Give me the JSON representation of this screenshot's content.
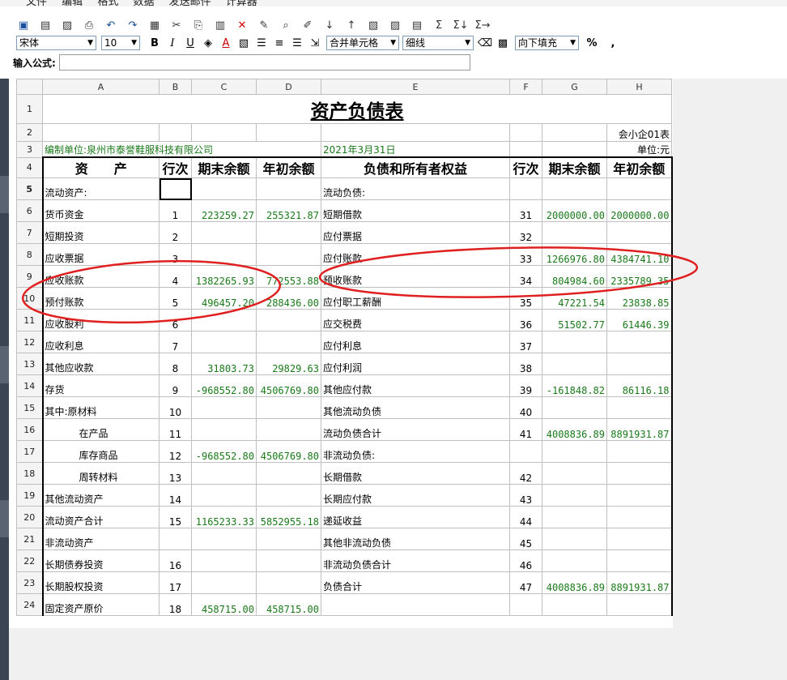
{
  "menu": [
    "文件",
    "编辑",
    "格式",
    "数据",
    "发送邮件",
    "计算器"
  ],
  "toolbar_icons": [
    "save-icon",
    "save-as-icon",
    "print-preview-icon",
    "print-icon",
    "undo-icon",
    "redo-icon",
    "insert-object-icon",
    "cut-icon",
    "copy-icon",
    "paste-icon",
    "delete-icon",
    "format-painter-icon",
    "find-icon",
    "replace-icon",
    "sort-ascending-icon",
    "sort-descending-icon",
    "paste-special-icon",
    "paste-value-icon",
    "clipboard-icon",
    "sum-icon",
    "sum-row-icon",
    "sum-col-icon"
  ],
  "toolbar_glyphs": [
    "▣",
    "▤",
    "▨",
    "⎙",
    "↶",
    "↷",
    "▦",
    "✂",
    "⎘",
    "▥",
    "✕",
    "✎",
    "⌕",
    "✐",
    "↓",
    "↑",
    "▧",
    "▨",
    "▤",
    "Σ",
    "Σ↓",
    "Σ→"
  ],
  "format": {
    "font": "宋体",
    "size": "10",
    "merge": "合并单元格",
    "border": "细线",
    "fill": "向下填充",
    "percent": "%",
    "comma": ","
  },
  "formula": {
    "label": "输入公式:",
    "value": ""
  },
  "columns": [
    "A",
    "B",
    "C",
    "D",
    "E",
    "F",
    "G",
    "H"
  ],
  "sheet": {
    "title": "资产负债表",
    "form_code": "会小企01表",
    "unit_label": "编制单位:泉州市泰誉鞋服科技有限公司",
    "date": "2021年3月31日",
    "currency": "单位:元",
    "headers": [
      "资　　产",
      "行次",
      "期末余额",
      "年初余额",
      "负债和所有者权益",
      "行次",
      "期末余额",
      "年初余额"
    ],
    "rows": [
      {
        "n": "5",
        "a": "流动资产:",
        "b": "",
        "c": "",
        "d": "",
        "e": "流动负债:",
        "f": "",
        "g": "",
        "h": ""
      },
      {
        "n": "6",
        "a": "货币资金",
        "b": "1",
        "c": "223259.27",
        "d": "255321.87",
        "e": "短期借款",
        "f": "31",
        "g": "2000000.00",
        "h": "2000000.00"
      },
      {
        "n": "7",
        "a": "短期投资",
        "b": "2",
        "c": "",
        "d": "",
        "e": "应付票据",
        "f": "32",
        "g": "",
        "h": ""
      },
      {
        "n": "8",
        "a": "应收票据",
        "b": "3",
        "c": "",
        "d": "",
        "e": "应付账款",
        "f": "33",
        "g": "1266976.80",
        "h": "4384741.10"
      },
      {
        "n": "9",
        "a": "应收账款",
        "b": "4",
        "c": "1382265.93",
        "d": "772553.88",
        "e": "预收账款",
        "f": "34",
        "g": "804984.60",
        "h": "2335789.35"
      },
      {
        "n": "10",
        "a": "预付账款",
        "b": "5",
        "c": "496457.20",
        "d": "288436.00",
        "e": "应付职工薪酬",
        "f": "35",
        "g": "47221.54",
        "h": "23838.85"
      },
      {
        "n": "11",
        "a": "应收股利",
        "b": "6",
        "c": "",
        "d": "",
        "e": "应交税费",
        "f": "36",
        "g": "51502.77",
        "h": "61446.39"
      },
      {
        "n": "12",
        "a": "应收利息",
        "b": "7",
        "c": "",
        "d": "",
        "e": "应付利息",
        "f": "37",
        "g": "",
        "h": ""
      },
      {
        "n": "13",
        "a": "其他应收款",
        "b": "8",
        "c": "31803.73",
        "d": "29829.63",
        "e": "应付利润",
        "f": "38",
        "g": "",
        "h": ""
      },
      {
        "n": "14",
        "a": "存货",
        "b": "9",
        "c": "-968552.80",
        "d": "4506769.80",
        "e": "其他应付款",
        "f": "39",
        "g": "-161848.82",
        "h": "86116.18"
      },
      {
        "n": "15",
        "a": "其中:原材料",
        "b": "10",
        "c": "",
        "d": "",
        "e": "其他流动负债",
        "f": "40",
        "g": "",
        "h": ""
      },
      {
        "n": "16",
        "a": "在产品",
        "b": "11",
        "c": "",
        "d": "",
        "e": "流动负债合计",
        "f": "41",
        "g": "4008836.89",
        "h": "8891931.87",
        "indent": true
      },
      {
        "n": "17",
        "a": "库存商品",
        "b": "12",
        "c": "-968552.80",
        "d": "4506769.80",
        "e": "非流动负债:",
        "f": "",
        "g": "",
        "h": "",
        "indent": true
      },
      {
        "n": "18",
        "a": "周转材料",
        "b": "13",
        "c": "",
        "d": "",
        "e": "长期借款",
        "f": "42",
        "g": "",
        "h": "",
        "indent": true
      },
      {
        "n": "19",
        "a": "其他流动资产",
        "b": "14",
        "c": "",
        "d": "",
        "e": "长期应付款",
        "f": "43",
        "g": "",
        "h": ""
      },
      {
        "n": "20",
        "a": "流动资产合计",
        "b": "15",
        "c": "1165233.33",
        "d": "5852955.18",
        "e": "递延收益",
        "f": "44",
        "g": "",
        "h": ""
      },
      {
        "n": "21",
        "a": "非流动资产",
        "b": "",
        "c": "",
        "d": "",
        "e": "其他非流动负债",
        "f": "45",
        "g": "",
        "h": ""
      },
      {
        "n": "22",
        "a": "长期债券投资",
        "b": "16",
        "c": "",
        "d": "",
        "e": "非流动负债合计",
        "f": "46",
        "g": "",
        "h": ""
      },
      {
        "n": "23",
        "a": "长期股权投资",
        "b": "17",
        "c": "",
        "d": "",
        "e": "负债合计",
        "f": "47",
        "g": "4008836.89",
        "h": "8891931.87"
      },
      {
        "n": "24",
        "a": "固定资产原价",
        "b": "18",
        "c": "458715.00",
        "d": "458715.00",
        "e": "",
        "f": "",
        "g": "",
        "h": ""
      }
    ]
  }
}
